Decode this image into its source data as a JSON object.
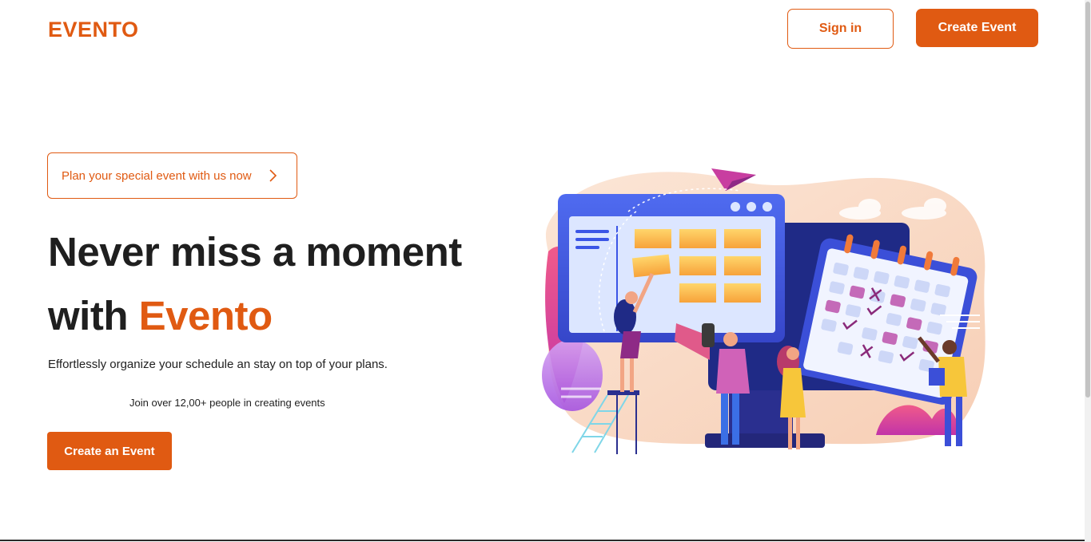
{
  "header": {
    "logo": "EVENTO",
    "sign_in_label": "Sign in",
    "create_event_label": "Create Event"
  },
  "hero": {
    "pill_text": "Plan your special event with us now",
    "headline_line1": "Never miss a moment",
    "headline_line2_prefix": "with ",
    "headline_line2_accent": "Evento",
    "subtitle": "Effortlessly organize your schedule an stay on top of your plans.",
    "join_text": "Join over 12,00+ people in creating events",
    "cta_label": "Create an Event"
  },
  "colors": {
    "brand": "#e05a12",
    "text": "#1f1f1f"
  },
  "icons": {
    "pill_arrow": "chevron-right-icon"
  }
}
